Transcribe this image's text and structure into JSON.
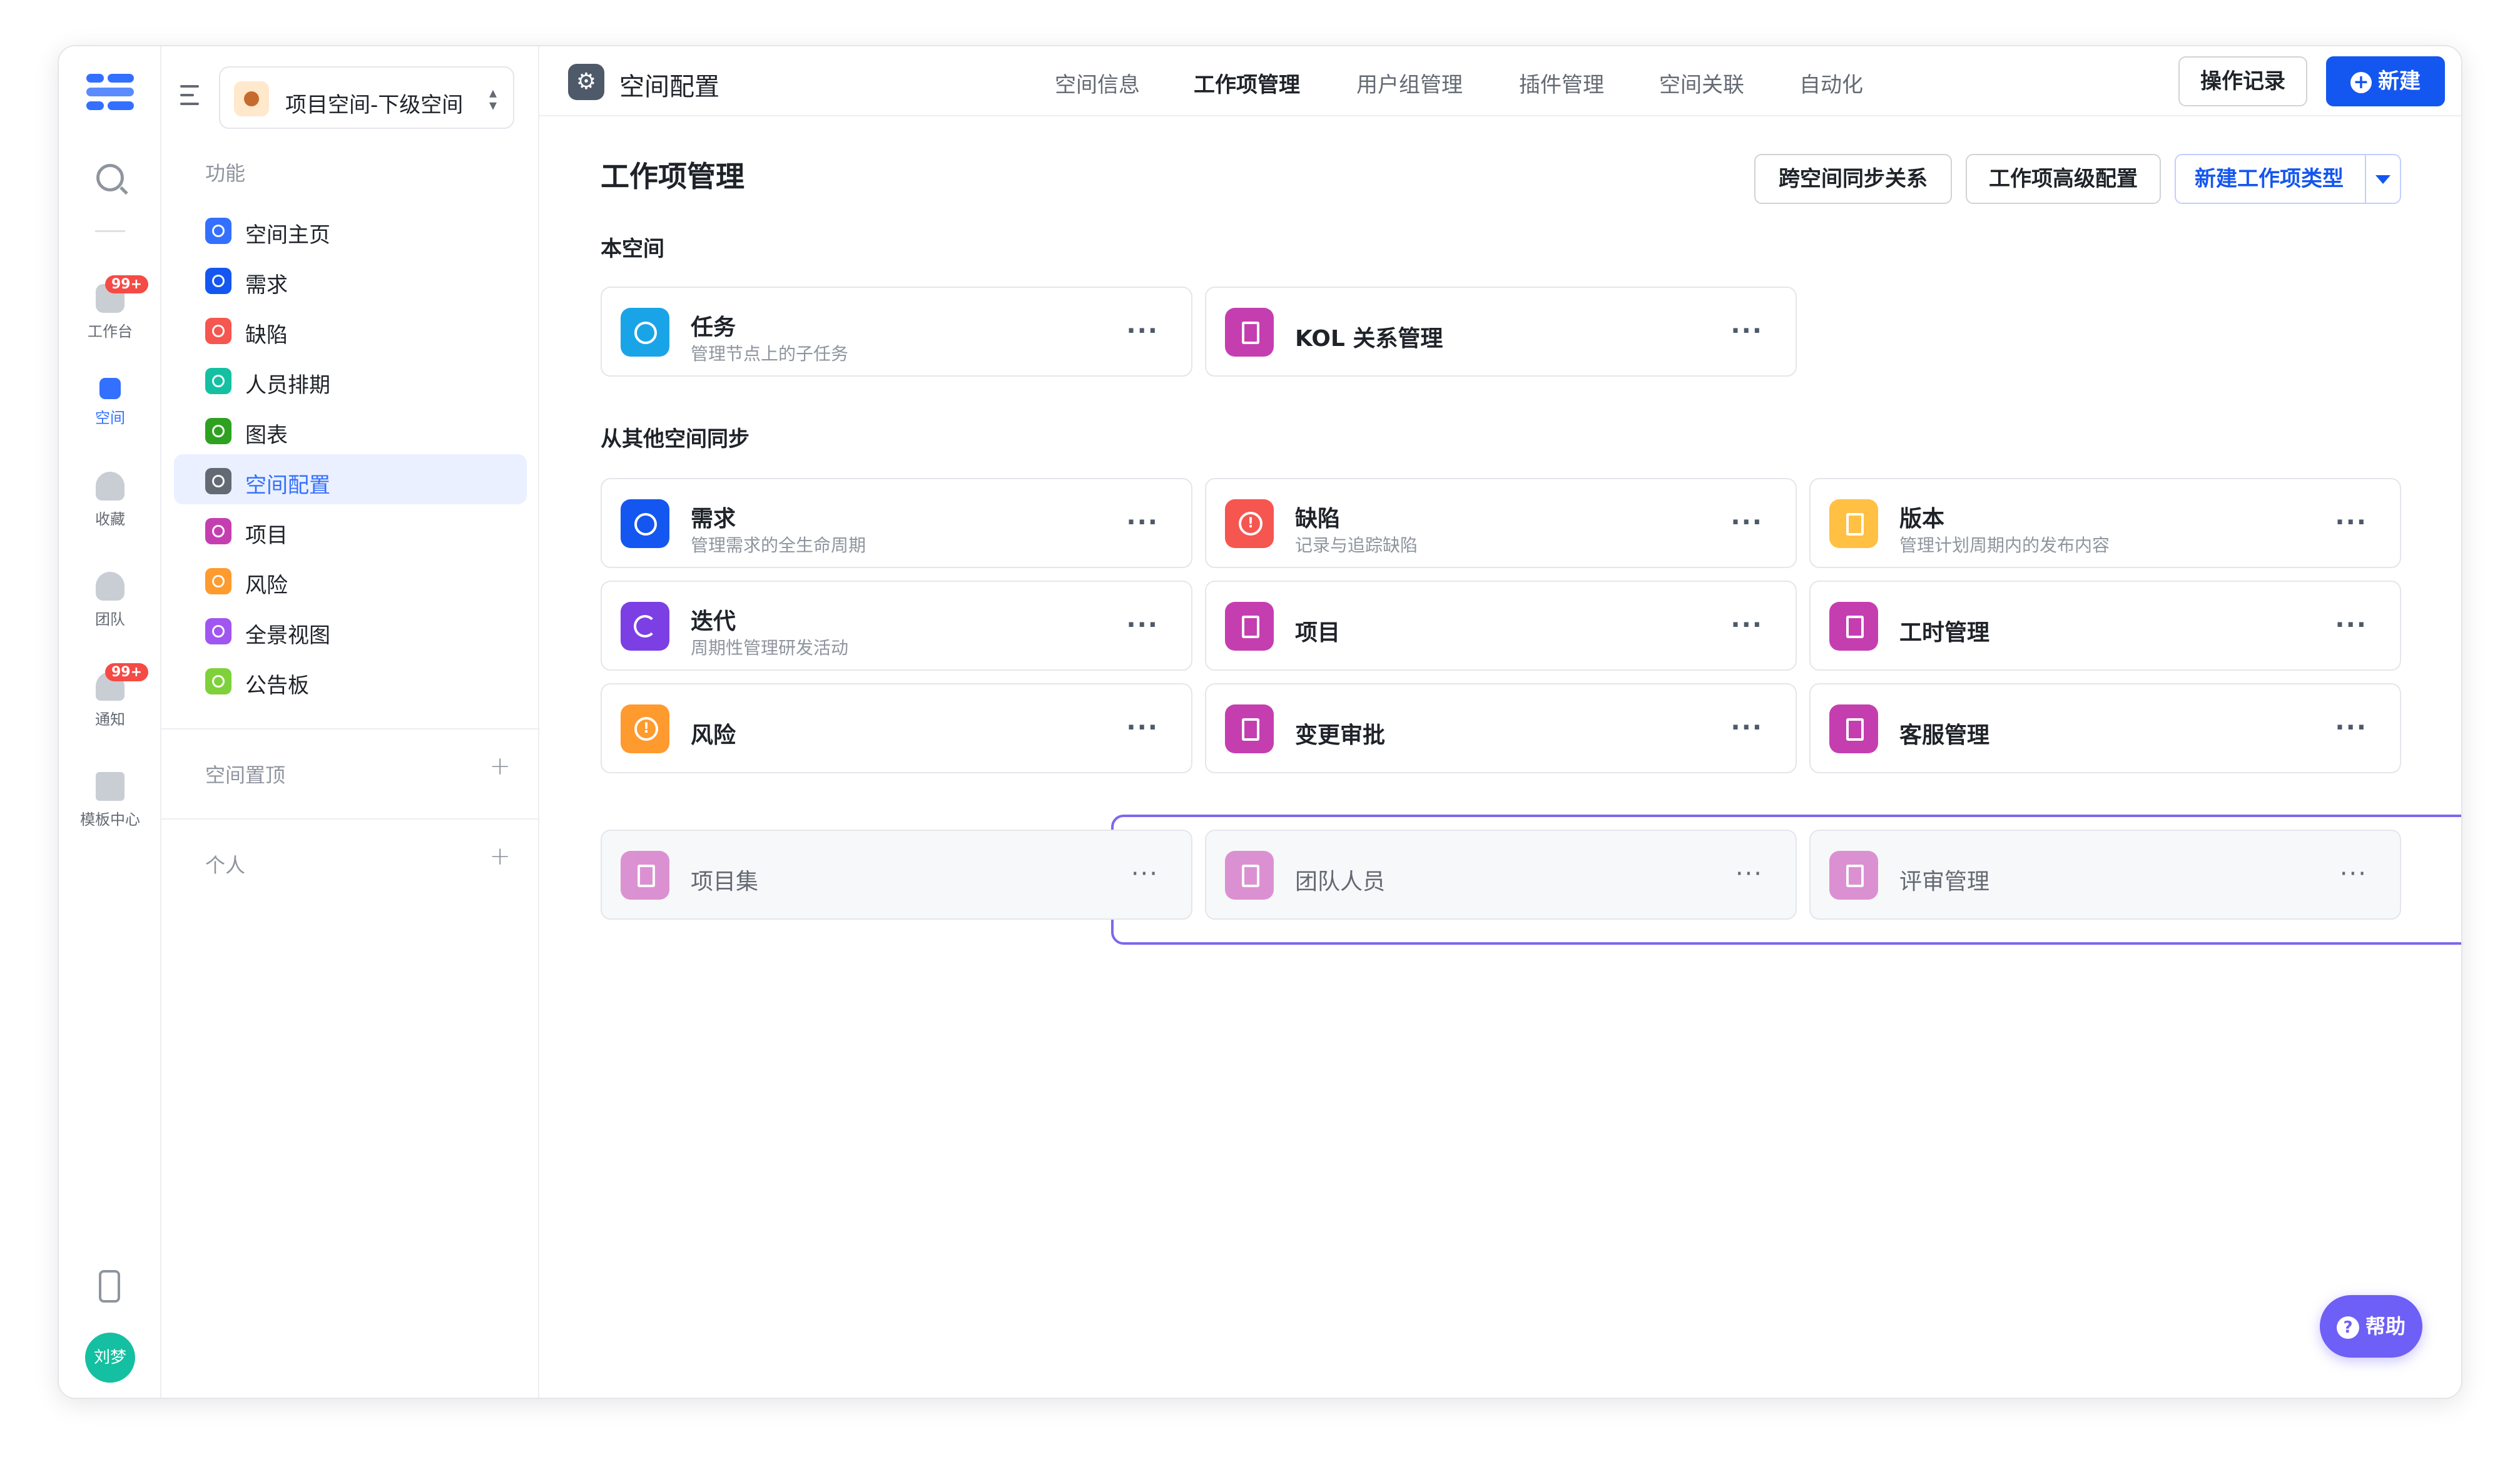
{
  "rail": {
    "items": [
      {
        "label": "工作台",
        "badge": "99+"
      },
      {
        "label": "空间"
      },
      {
        "label": "收藏"
      },
      {
        "label": "团队"
      },
      {
        "label": "通知",
        "badge": "99+"
      },
      {
        "label": "模板中心"
      }
    ],
    "avatar": "刘梦"
  },
  "sidebar": {
    "space_name": "项目空间-下级空间",
    "section_label": "功能",
    "items": [
      {
        "label": "空间主页",
        "color": "#3370ff"
      },
      {
        "label": "需求",
        "color": "#1456f0"
      },
      {
        "label": "缺陷",
        "color": "#f5564f"
      },
      {
        "label": "人员排期",
        "color": "#14c0a1"
      },
      {
        "label": "图表",
        "color": "#2ea121"
      },
      {
        "label": "空间配置",
        "color": "#646a73"
      },
      {
        "label": "项目",
        "color": "#c53eb0"
      },
      {
        "label": "风险",
        "color": "#ff9a2e"
      },
      {
        "label": "全景视图",
        "color": "#a056f0"
      },
      {
        "label": "公告板",
        "color": "#7fd13b"
      }
    ],
    "pinned_label": "空间置顶",
    "personal_label": "个人"
  },
  "topbar": {
    "title": "空间配置",
    "tabs": [
      "空间信息",
      "工作项管理",
      "用户组管理",
      "插件管理",
      "空间关联",
      "自动化"
    ],
    "active_tab": "工作项管理",
    "history_button": "操作记录",
    "new_button": "新建"
  },
  "main": {
    "title": "工作项管理",
    "buttons": {
      "sync": "跨空间同步关系",
      "advanced": "工作项高级配置",
      "new_type": "新建工作项类型"
    },
    "this_space_label": "本空间",
    "this_space_cards": [
      {
        "title": "任务",
        "desc": "管理节点上的子任务",
        "color": "#1aa4e8",
        "icon": "check-circle-icon"
      },
      {
        "title": "KOL 关系管理",
        "color": "#c53eb0",
        "icon": "bookmark-icon"
      }
    ],
    "synced_label": "从其他空间同步",
    "synced_cards": [
      {
        "title": "需求",
        "desc": "管理需求的全生命周期",
        "color": "#1456f0",
        "icon": "check-circle-icon"
      },
      {
        "title": "缺陷",
        "desc": "记录与追踪缺陷",
        "color": "#f5564f",
        "icon": "alert-circle-icon"
      },
      {
        "title": "版本",
        "desc": "管理计划周期内的发布内容",
        "color": "#ffc043",
        "icon": "bookmark-icon"
      },
      {
        "title": "迭代",
        "desc": "周期性管理研发活动",
        "color": "#7c3fe4",
        "icon": "cycle-icon"
      },
      {
        "title": "项目",
        "color": "#c53eb0",
        "icon": "bookmark-icon"
      },
      {
        "title": "工时管理",
        "color": "#c53eb0",
        "icon": "bookmark-icon"
      },
      {
        "title": "风险",
        "color": "#ff9a2e",
        "icon": "alert-circle-icon"
      },
      {
        "title": "变更审批",
        "color": "#c53eb0",
        "icon": "bookmark-icon"
      },
      {
        "title": "客服管理",
        "color": "#c53eb0",
        "icon": "bookmark-icon"
      },
      {
        "title": "项目集",
        "color": "#c53eb0",
        "icon": "bookmark-icon",
        "disabled": true
      },
      {
        "title": "团队人员",
        "color": "#c53eb0",
        "icon": "bookmark-icon",
        "disabled": true
      },
      {
        "title": "评审管理",
        "color": "#c53eb0",
        "icon": "bookmark-icon",
        "disabled": true
      }
    ]
  },
  "help_label": "帮助",
  "colors": {
    "accent": "#1456f0",
    "highlight": "#7b68ee",
    "help": "#6e5ff6"
  }
}
